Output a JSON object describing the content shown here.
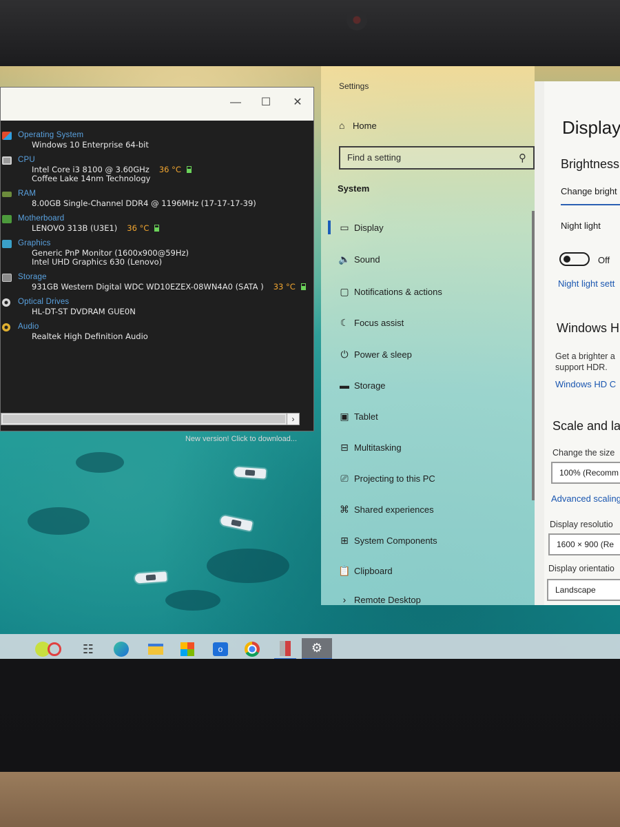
{
  "speccy": {
    "sections": [
      {
        "title": "Operating System",
        "icon": "windows-logo-icon",
        "lines": [
          "Windows 10 Enterprise 64-bit"
        ]
      },
      {
        "title": "CPU",
        "icon": "cpu-icon",
        "lines": [
          "Intel Core i3 8100 @ 3.60GHz",
          "Coffee Lake 14nm Technology"
        ],
        "temp": "36 °C"
      },
      {
        "title": "RAM",
        "icon": "ram-icon",
        "lines": [
          "8.00GB Single-Channel DDR4 @ 1196MHz (17-17-17-39)"
        ]
      },
      {
        "title": "Motherboard",
        "icon": "motherboard-icon",
        "lines": [
          "LENOVO 313B (U3E1)"
        ],
        "temp": "36 °C"
      },
      {
        "title": "Graphics",
        "icon": "monitor-icon",
        "lines": [
          "Generic PnP Monitor (1600x900@59Hz)",
          "Intel UHD Graphics 630 (Lenovo)"
        ]
      },
      {
        "title": "Storage",
        "icon": "hdd-icon",
        "lines": [
          "931GB Western Digital WDC WD10EZEX-08WN4A0 (SATA )"
        ],
        "temp": "33 °C"
      },
      {
        "title": "Optical Drives",
        "icon": "disc-icon",
        "lines": [
          "HL-DT-ST DVDRAM GUE0N"
        ]
      },
      {
        "title": "Audio",
        "icon": "speaker-icon",
        "lines": [
          "Realtek High Definition Audio"
        ]
      }
    ],
    "status": "New version! Click to download..."
  },
  "settings": {
    "window_title": "Settings",
    "home_label": "Home",
    "search_placeholder": "Find a setting",
    "section_label": "System",
    "nav_items": [
      {
        "label": "Display",
        "icon": "monitor-icon",
        "active": true
      },
      {
        "label": "Sound",
        "icon": "speaker-icon"
      },
      {
        "label": "Notifications & actions",
        "icon": "notification-icon"
      },
      {
        "label": "Focus assist",
        "icon": "moon-icon"
      },
      {
        "label": "Power & sleep",
        "icon": "power-icon"
      },
      {
        "label": "Storage",
        "icon": "storage-icon"
      },
      {
        "label": "Tablet",
        "icon": "tablet-icon"
      },
      {
        "label": "Multitasking",
        "icon": "multitasking-icon"
      },
      {
        "label": "Projecting to this PC",
        "icon": "project-icon"
      },
      {
        "label": "Shared experiences",
        "icon": "shared-icon"
      },
      {
        "label": "System Components",
        "icon": "components-icon"
      },
      {
        "label": "Clipboard",
        "icon": "clipboard-icon"
      },
      {
        "label": "Remote Desktop",
        "icon": "remote-icon"
      }
    ],
    "main": {
      "page_title": "Display",
      "brightness_heading": "Brightness",
      "brightness_text": "Change bright",
      "night_light_label": "Night light",
      "night_light_state": "Off",
      "night_light_link": "Night light sett",
      "hdr_heading": "Windows H",
      "hdr_text_1": "Get a brighter a",
      "hdr_text_2": "support HDR.",
      "hdr_link": "Windows HD C",
      "scale_heading": "Scale and la",
      "scale_text": "Change the size",
      "scale_value": "100% (Recomm",
      "advanced_scaling_link": "Advanced scaling",
      "resolution_label": "Display resolutio",
      "resolution_value": "1600 × 900 (Re",
      "orientation_label": "Display orientatio",
      "orientation_value": "Landscape"
    }
  },
  "taskbar": {
    "apps": [
      "tennis-app-icon",
      "task-view-icon",
      "edge-icon",
      "file-explorer-icon",
      "store-icon",
      "outlook-icon",
      "chrome-icon",
      "speccy-icon",
      "settings-gear-icon"
    ]
  }
}
